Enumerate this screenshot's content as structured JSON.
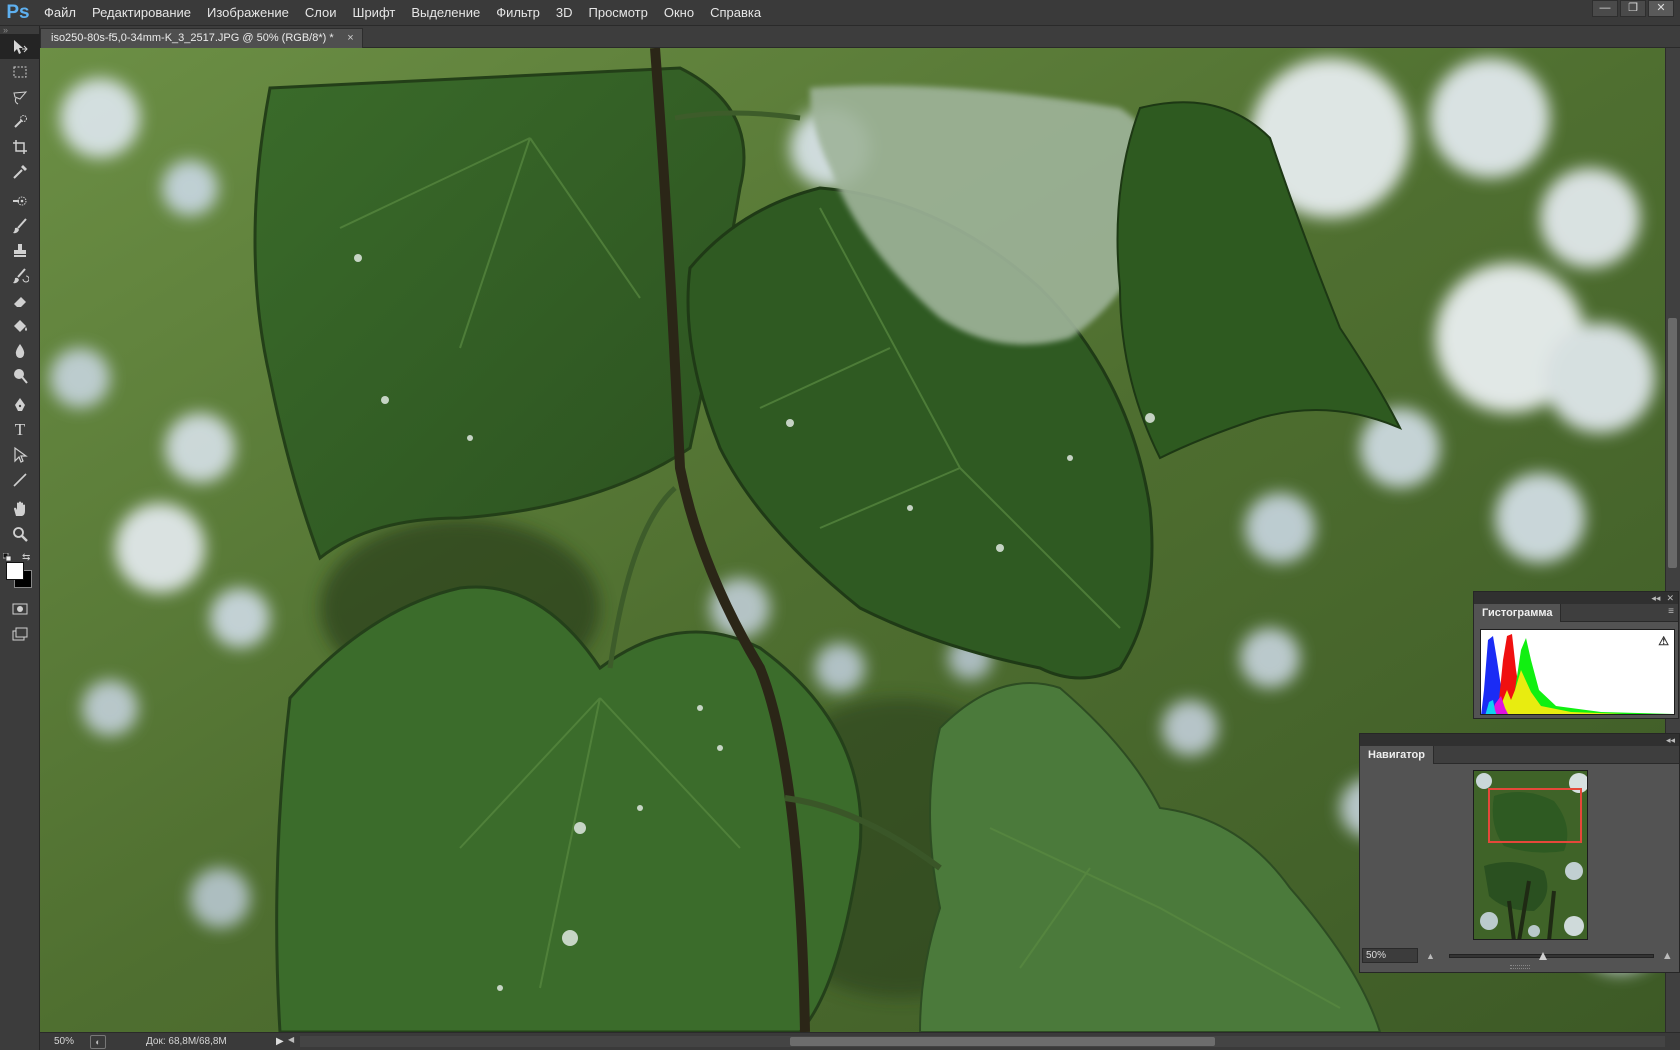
{
  "app": {
    "logo_text": "Ps"
  },
  "menu": [
    "Файл",
    "Редактирование",
    "Изображение",
    "Слои",
    "Шрифт",
    "Выделение",
    "Фильтр",
    "3D",
    "Просмотр",
    "Окно",
    "Справка"
  ],
  "window_controls": {
    "minimize": "—",
    "restore": "❐",
    "close": "✕"
  },
  "document": {
    "tab_title": "iso250-80s-f5,0-34mm-K_3_2517.JPG @ 50% (RGB/8*) *",
    "close_glyph": "×"
  },
  "toolbar": {
    "grip": "»",
    "tools": [
      {
        "name": "move-tool",
        "active": true
      },
      {
        "name": "rectangular-marquee-tool"
      },
      {
        "name": "lasso-tool"
      },
      {
        "name": "quick-selection-tool"
      },
      {
        "name": "crop-tool"
      },
      {
        "name": "eyedropper-tool"
      },
      {
        "name": "spot-healing-brush-tool"
      },
      {
        "name": "brush-tool"
      },
      {
        "name": "clone-stamp-tool"
      },
      {
        "name": "history-brush-tool"
      },
      {
        "name": "eraser-tool"
      },
      {
        "name": "paint-bucket-tool"
      },
      {
        "name": "blur-tool"
      },
      {
        "name": "dodge-tool"
      },
      {
        "name": "pen-tool"
      },
      {
        "name": "type-tool",
        "glyph": "T"
      },
      {
        "name": "path-selection-tool"
      },
      {
        "name": "line-tool"
      },
      {
        "name": "hand-tool"
      },
      {
        "name": "zoom-tool"
      },
      {
        "name": "quick-mask-mode"
      },
      {
        "name": "screen-mode"
      }
    ],
    "foreground_color": "#ffffff",
    "background_color": "#000000"
  },
  "statusbar": {
    "zoom": "50%",
    "doc_info": "Док: 68,8M/68,8M",
    "arrow": "▶"
  },
  "histogram_panel": {
    "tab_label": "Гистограмма",
    "warning_glyph": "⚠",
    "menu_glyph": "≡"
  },
  "navigator_panel": {
    "tab_label": "Навигатор",
    "zoom_value": "50%",
    "zoom_out_glyph": "▲",
    "zoom_in_glyph": "▲"
  },
  "panel_controls": {
    "collapse": "◂◂",
    "close": "✕"
  }
}
